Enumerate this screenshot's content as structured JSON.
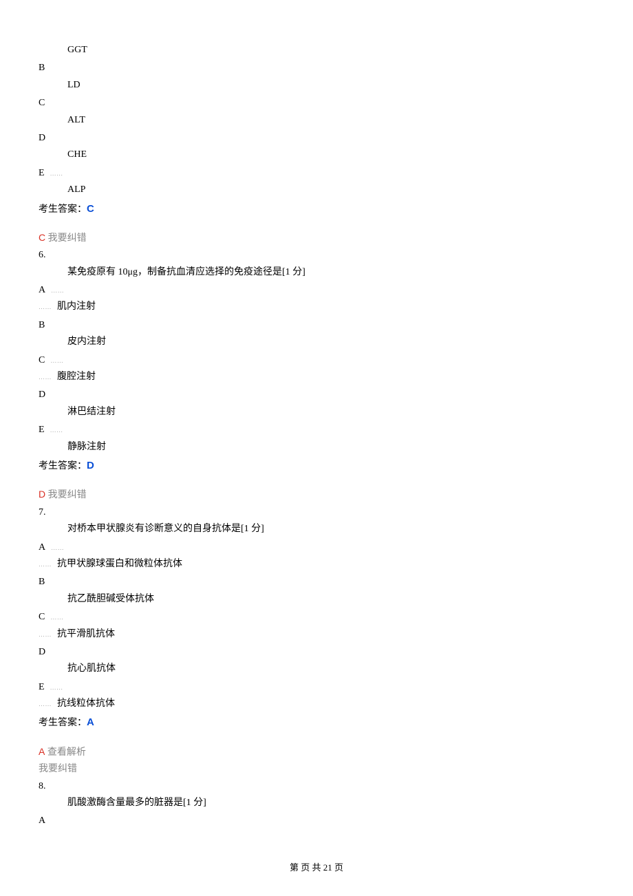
{
  "q5_cont": {
    "optB": {
      "letter": "B",
      "text": "GGT"
    },
    "optC": {
      "letter": "C",
      "text": "LD"
    },
    "optD": {
      "letter": "D",
      "text": "ALT"
    },
    "optE": {
      "letter": "E",
      "text": "CHE"
    },
    "after": "ALP",
    "answer_label": "考生答案：",
    "answer": "C",
    "correct": "C",
    "correct_link": " 我要纠错"
  },
  "q6": {
    "num": "6.",
    "text": "某免疫原有 10μg，制备抗血清应选择的免疫途径是[1 分]",
    "optA": {
      "letter": "A",
      "text": "肌内注射"
    },
    "optB": {
      "letter": "B",
      "text": "皮内注射"
    },
    "optC": {
      "letter": "C",
      "text": "腹腔注射"
    },
    "optD": {
      "letter": "D",
      "text": "淋巴结注射"
    },
    "optE": {
      "letter": "E",
      "text": "静脉注射"
    },
    "answer_label": "考生答案：",
    "answer": "D",
    "correct": "D",
    "correct_link": " 我要纠错"
  },
  "q7": {
    "num": "7.",
    "text": "对桥本甲状腺炎有诊断意义的自身抗体是[1 分]",
    "optA": {
      "letter": "A",
      "text": "抗甲状腺球蛋白和微粒体抗体"
    },
    "optB": {
      "letter": "B",
      "text": "抗乙酰胆碱受体抗体"
    },
    "optC": {
      "letter": "C",
      "text": "抗平滑肌抗体"
    },
    "optD": {
      "letter": "D",
      "text": "抗心肌抗体"
    },
    "optE": {
      "letter": "E",
      "text": "抗线粒体抗体"
    },
    "answer_label": "考生答案：",
    "answer": "A",
    "correct": "A",
    "view_link": " 查看解析",
    "correct_link": "我要纠错"
  },
  "q8": {
    "num": "8.",
    "text": "肌酸激酶含量最多的脏器是[1 分]",
    "optA": {
      "letter": "A"
    }
  },
  "footer": "第  页 共 21 页",
  "dots": "……"
}
